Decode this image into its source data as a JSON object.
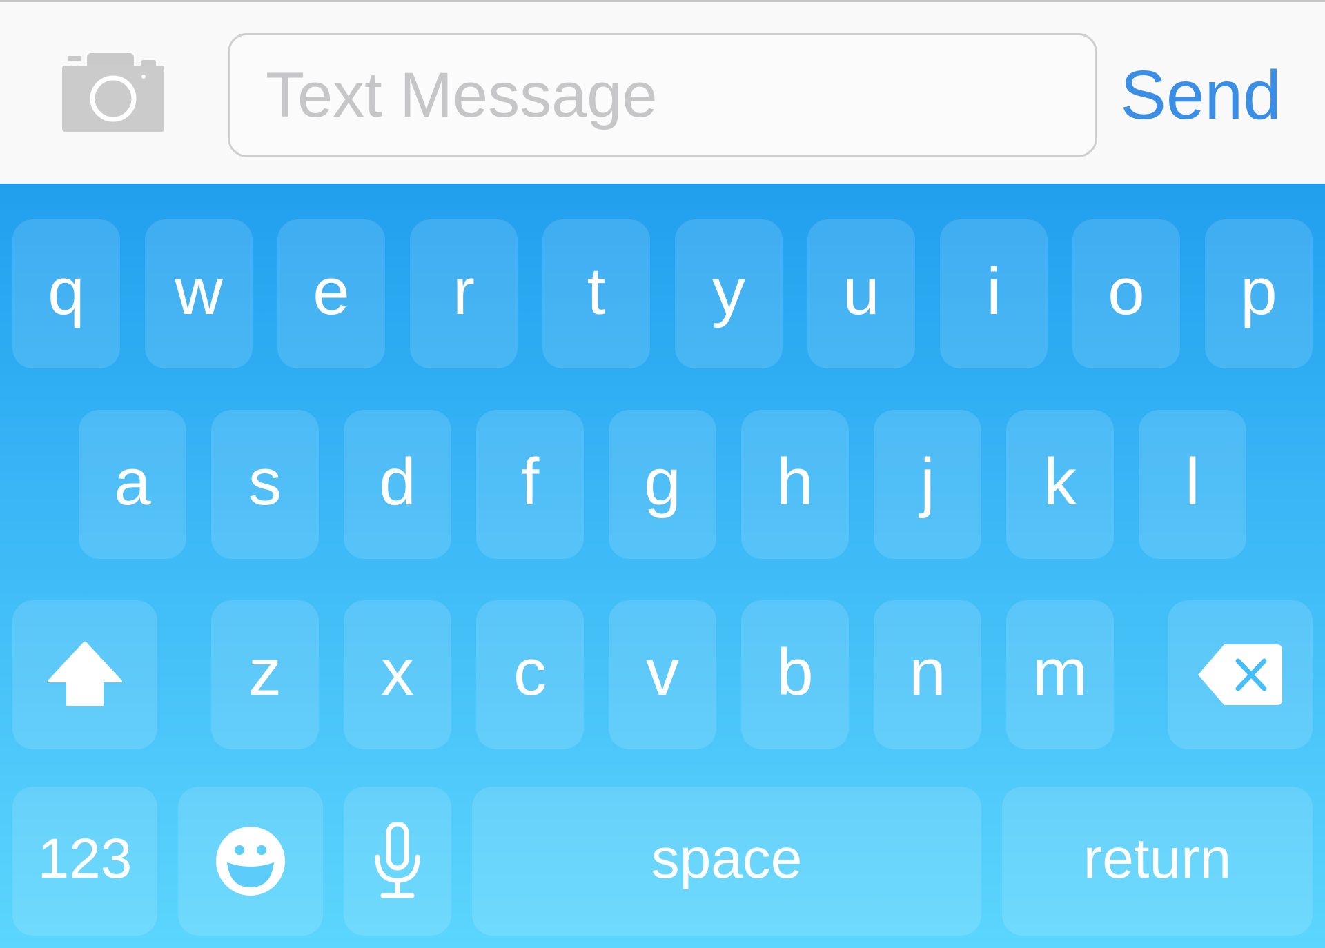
{
  "input_bar": {
    "camera_icon": "camera-icon",
    "message_placeholder": "Text Message",
    "message_value": "",
    "send_label": "Send",
    "send_color": "#3a8ee6",
    "placeholder_color": "#c6c6c8"
  },
  "keyboard": {
    "row1": [
      "q",
      "w",
      "e",
      "r",
      "t",
      "y",
      "u",
      "i",
      "o",
      "p"
    ],
    "row2": [
      "a",
      "s",
      "d",
      "f",
      "g",
      "h",
      "j",
      "k",
      "l"
    ],
    "row3": [
      "z",
      "x",
      "c",
      "v",
      "b",
      "n",
      "m"
    ],
    "shift_icon": "shift-arrow-icon",
    "delete_icon": "delete-backspace-icon",
    "numbers_label": "123",
    "emoji_icon": "emoji-smiley-icon",
    "dictation_icon": "microphone-icon",
    "space_label": "space",
    "return_label": "return",
    "gradient_top_color": "#219fee",
    "gradient_bottom_color": "#5bd6fd"
  }
}
